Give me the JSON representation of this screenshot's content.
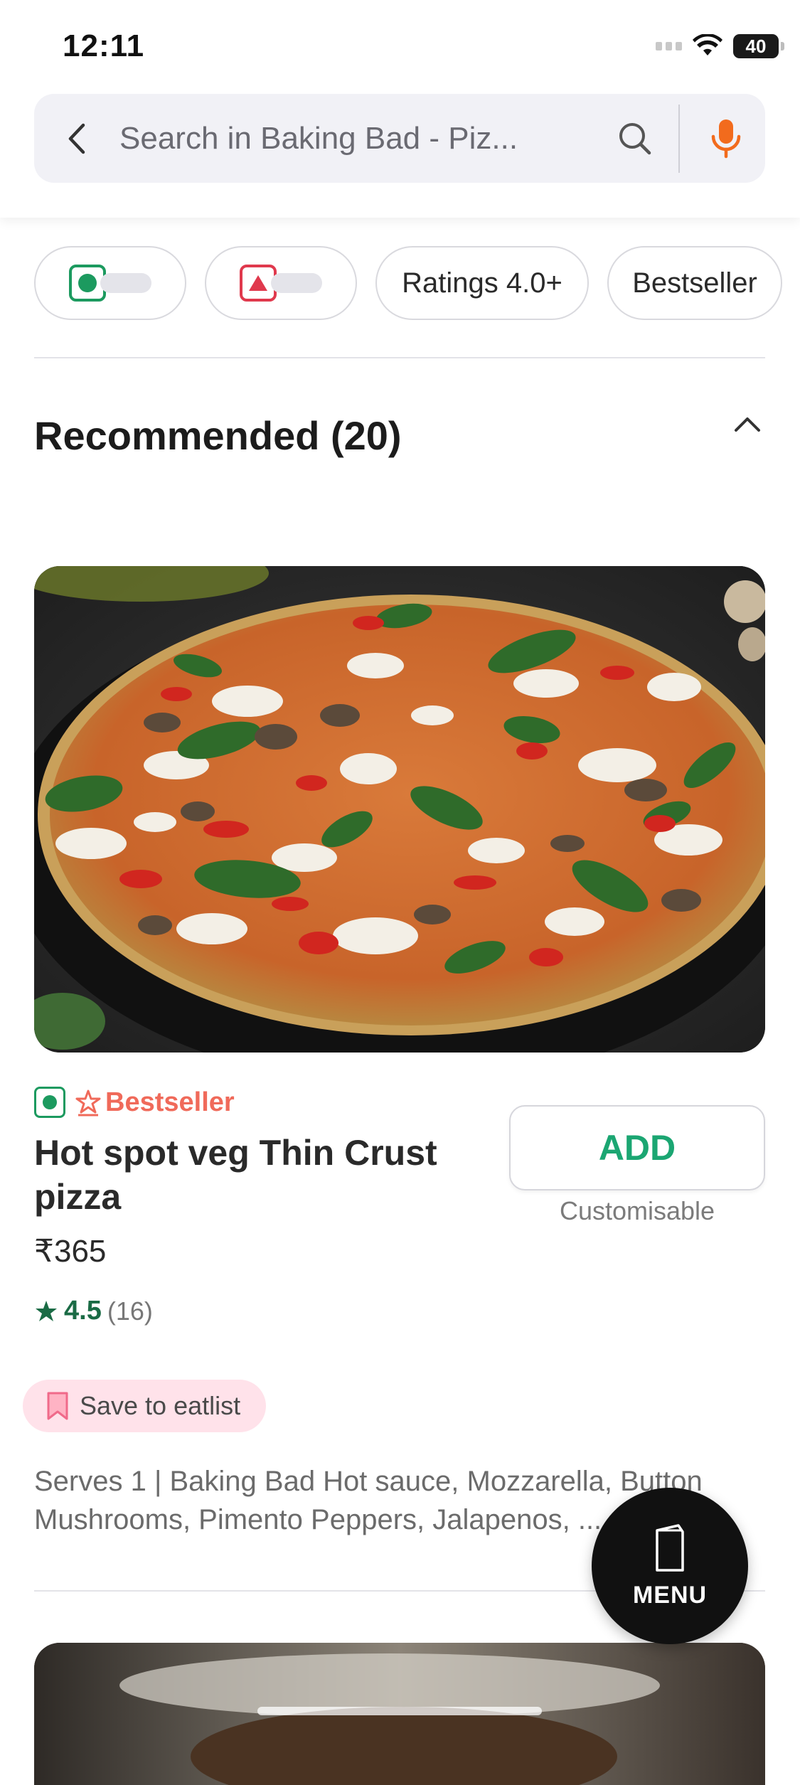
{
  "status_bar": {
    "time": "12:11",
    "battery": "40"
  },
  "search": {
    "placeholder": "Search in Baking Bad - Piz..."
  },
  "filters": [
    {
      "label": "",
      "icon": "veg-toggle-icon"
    },
    {
      "label": "",
      "icon": "nonveg-toggle-icon"
    },
    {
      "label": "Ratings 4.0+"
    },
    {
      "label": "Bestseller"
    }
  ],
  "section": {
    "title": "Recommended (20)"
  },
  "dish": {
    "tag": "Bestseller",
    "name": "Hot spot veg Thin Crust pizza",
    "price": "₹365",
    "rating": "4.5",
    "rating_count": "(16)",
    "add_label": "ADD",
    "customisable": "Customisable",
    "save_label": "Save to eatlist",
    "description": "Serves 1 | Baking Bad Hot sauce, Mozzarella, Button Mushrooms, Pimento Peppers, Jalapenos, ..."
  },
  "fab": {
    "label": "MENU"
  },
  "colors": {
    "veg": "#1c9a5f",
    "nonveg": "#e0394d",
    "accent_orange": "#f26b1d",
    "add_green": "#1ba672",
    "rating_green": "#1a6b45",
    "bestseller": "#f06a5a"
  }
}
